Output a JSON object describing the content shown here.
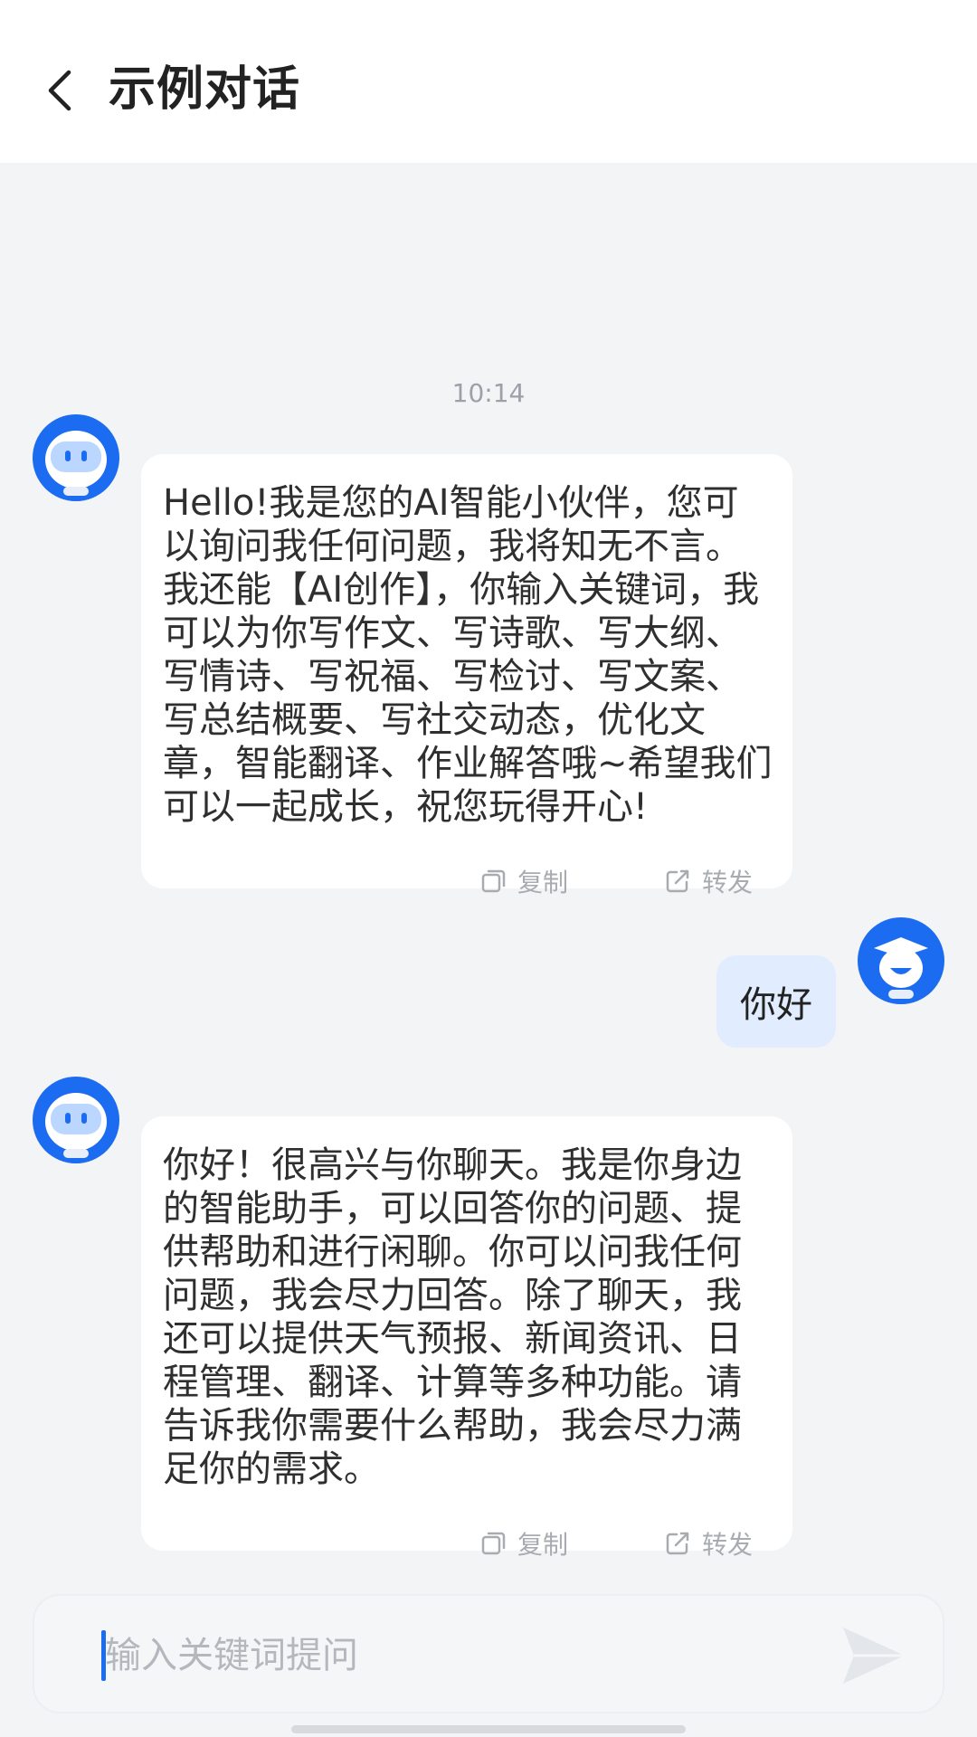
{
  "header": {
    "title": "示例对话"
  },
  "chat": {
    "timestamp": "10:14",
    "messages": [
      {
        "role": "bot",
        "text": "Hello!我是您的AI智能小伙伴，您可以询问我任何问题，我将知无不言。我还能【AI创作】，你输入关键词，我可以为你写作文、写诗歌、写大纲、写情诗、写祝福、写检讨、写文案、写总结概要、写社交动态，优化文章，智能翻译、作业解答哦~希望我们可以一起成长，祝您玩得开心!"
      },
      {
        "role": "user",
        "text": "你好"
      },
      {
        "role": "bot",
        "text": "你好！很高兴与你聊天。我是你身边的智能助手，可以回答你的问题、提供帮助和进行闲聊。你可以问我任何问题，我会尽力回答。除了聊天，我还可以提供天气预报、新闻资讯、日程管理、翻译、计算等多种功能。请告诉我你需要什么帮助，我会尽力满足你的需求。"
      }
    ],
    "actions": {
      "copy_label": "复制",
      "forward_label": "转发"
    }
  },
  "input": {
    "placeholder": "输入关键词提问"
  },
  "colors": {
    "accent": "#1c6cf2",
    "user_bubble": "#e1edff",
    "background": "#f3f4f6"
  },
  "icons": [
    "back-arrow-icon",
    "robot-avatar-icon",
    "user-avatar-icon",
    "copy-icon",
    "forward-icon",
    "send-icon"
  ]
}
